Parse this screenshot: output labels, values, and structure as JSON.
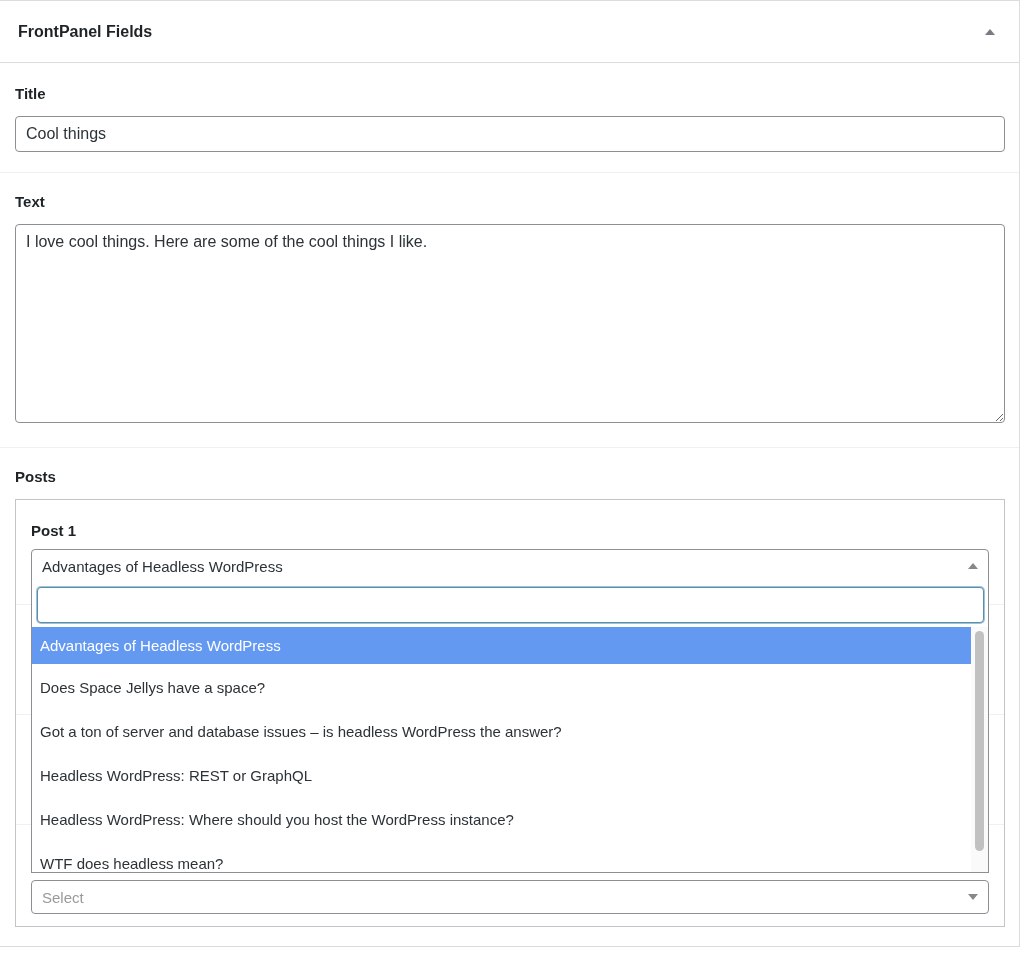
{
  "panel": {
    "title": "FrontPanel Fields",
    "expanded": true
  },
  "title_field": {
    "label": "Title",
    "value": "Cool things"
  },
  "text_field": {
    "label": "Text",
    "value": "I love cool things. Here are some of the cool things I like."
  },
  "posts": {
    "label": "Posts",
    "post_1": {
      "label": "Post 1",
      "value": "Advantages of Headless WordPress",
      "expanded": true
    },
    "dropdown": {
      "options": [
        {
          "label": "Advantages of Headless WordPress",
          "selected": true
        },
        {
          "label": "Does Space Jellys have a space?",
          "selected": false
        },
        {
          "label": "Got a ton of server and database issues – is headless WordPress the answer?",
          "selected": false
        },
        {
          "label": "Headless WordPress: REST or GraphQL",
          "selected": false
        },
        {
          "label": "Headless WordPress: Where should you host the WordPress instance?",
          "selected": false
        },
        {
          "label": "WTF does headless mean?",
          "selected": false
        }
      ]
    },
    "last_select": {
      "placeholder": "Select",
      "expanded": false
    }
  }
}
